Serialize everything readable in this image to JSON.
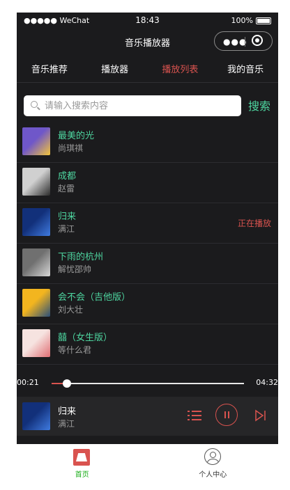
{
  "status_bar": {
    "carrier": "●●●●● WeChat",
    "time": "18:43",
    "battery": "100%"
  },
  "nav": {
    "title": "音乐播放器",
    "capsule_dots": "●●●"
  },
  "tabs": [
    {
      "label": "音乐推荐",
      "active": false
    },
    {
      "label": "播放器",
      "active": false
    },
    {
      "label": "播放列表",
      "active": true
    },
    {
      "label": "我的音乐",
      "active": false
    }
  ],
  "search": {
    "placeholder": "请输入搜索内容",
    "value": "",
    "button": "搜索"
  },
  "songs": [
    {
      "title": "最美的光",
      "artist": "尚琪祺",
      "status": "",
      "cover_colors": [
        "#6f57c9",
        "#f3c43a"
      ]
    },
    {
      "title": "成都",
      "artist": "赵雷",
      "status": "",
      "cover_colors": [
        "#d0d0d0",
        "#2a2a2a"
      ]
    },
    {
      "title": "归来",
      "artist": "满江",
      "status": "正在播放",
      "cover_colors": [
        "#12307a",
        "#3f7be0"
      ]
    },
    {
      "title": "下雨的杭州",
      "artist": "解忧邵帅",
      "status": "",
      "cover_colors": [
        "#707070",
        "#d8d8d8"
      ]
    },
    {
      "title": "会不会（吉他版）",
      "artist": "刘大壮",
      "status": "",
      "cover_colors": [
        "#f3b51f",
        "#2a4f7a"
      ]
    },
    {
      "title": "囍（女生版）",
      "artist": "等什么君",
      "status": "",
      "cover_colors": [
        "#f6e3e0",
        "#e06e73"
      ]
    },
    {
      "title": "",
      "artist": "",
      "status": "",
      "cover_colors": [
        "#0b3c3c",
        "#22b9b2"
      ]
    }
  ],
  "player": {
    "current_time": "00:21",
    "total_time": "04:32",
    "progress": 0.08,
    "now_title": "归来",
    "now_artist": "满江",
    "cover_colors": [
      "#12307a",
      "#3f7be0"
    ],
    "accent": "#d9534f",
    "name_color": "#4ed6a0"
  },
  "tabbar": [
    {
      "label": "首页",
      "icon": "home-icon",
      "color": "#1aad19"
    },
    {
      "label": "个人中心",
      "icon": "user-icon",
      "color": "#333333"
    }
  ]
}
